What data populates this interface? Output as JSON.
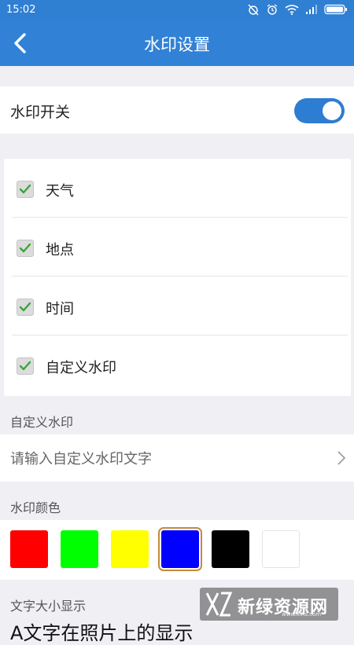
{
  "status_bar": {
    "time": "15:02",
    "icons": [
      "alarm-off-icon",
      "alarm-clock-icon",
      "wifi-icon",
      "signal-icon",
      "battery-icon"
    ]
  },
  "header": {
    "back_icon": "back-arrow-icon",
    "title": "水印设置"
  },
  "watermark_switch": {
    "label": "水印开关",
    "enabled": true
  },
  "options": [
    {
      "label": "天气",
      "checked": true
    },
    {
      "label": "地点",
      "checked": true
    },
    {
      "label": "时间",
      "checked": true
    },
    {
      "label": "自定义水印",
      "checked": true
    }
  ],
  "custom_watermark": {
    "section_title": "自定义水印",
    "placeholder": "请输入自定义水印文字"
  },
  "color_section": {
    "title": "水印颜色",
    "colors": [
      "#ff0000",
      "#00ff00",
      "#ffff00",
      "#0000ff",
      "#000000",
      "#ffffff"
    ],
    "selected_index": 3
  },
  "text_size": {
    "title": "文字大小显示",
    "preview": "A文字在照片上的显示"
  },
  "site_watermark": {
    "name": "新绿资源网",
    "url": "www.xlhs.com"
  },
  "accent_color": "#3182d6"
}
